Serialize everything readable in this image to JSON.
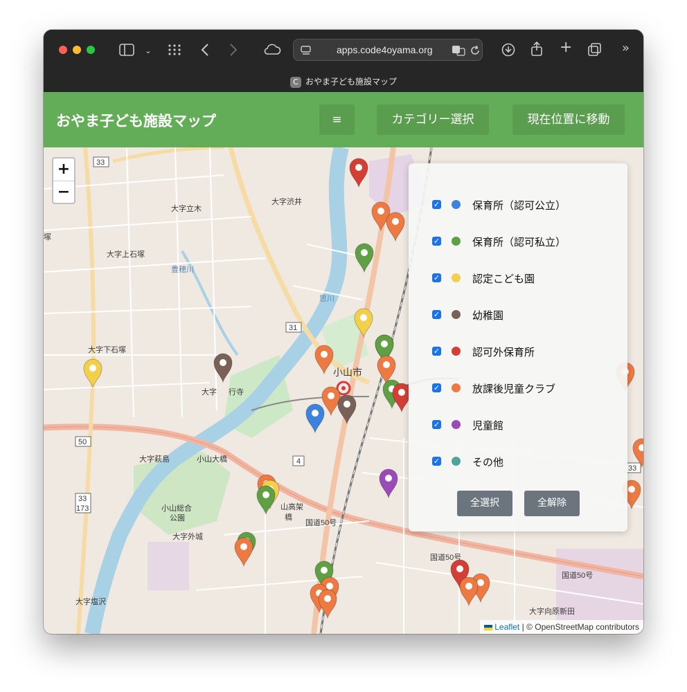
{
  "browser": {
    "url": "apps.code4oyama.org",
    "tab_title": "おやま子ども施設マップ",
    "tab_favicon": "C"
  },
  "header": {
    "title": "おやま子ども施設マップ",
    "menu_icon": "≡",
    "category_button": "カテゴリー選択",
    "location_button": "現在位置に移動"
  },
  "zoom": {
    "in": "+",
    "out": "−"
  },
  "categories": [
    {
      "label": "保育所（認可公立）",
      "color": "#3d83dd",
      "checked": true
    },
    {
      "label": "保育所（認可私立）",
      "color": "#5fa044",
      "checked": true
    },
    {
      "label": "認定こども園",
      "color": "#f2d04a",
      "checked": true
    },
    {
      "label": "幼稚園",
      "color": "#7a6158",
      "checked": true
    },
    {
      "label": "認可外保育所",
      "color": "#d33f35",
      "checked": true
    },
    {
      "label": "放課後児童クラブ",
      "color": "#ee7a43",
      "checked": true
    },
    {
      "label": "児童館",
      "color": "#9b4bb5",
      "checked": true
    },
    {
      "label": "その他",
      "color": "#4fa39a",
      "checked": true
    }
  ],
  "panel": {
    "select_all": "全選択",
    "clear_all": "全解除"
  },
  "attribution": {
    "leaflet": "Leaflet",
    "separator": "|",
    "osm": "© OpenStreetMap contributors"
  },
  "map_labels": {
    "l1": "大字渋井",
    "l2": "大字立木",
    "l3": "大字上石塚",
    "l4": "大字下石塚",
    "l5": "大字",
    "l6": "行寺",
    "l7": "大字萩島",
    "l8": "小山大橋",
    "l9": "小山市",
    "l10": "大字外城",
    "l11": "大字塩沢",
    "l12": "山高架",
    "l13": "橋",
    "l14": "大字向原新田",
    "l15": "国道50号",
    "l16": "国道50号",
    "l17": "国道50号",
    "l18": "小山総合",
    "l19": "公園",
    "l20": "思川",
    "l21": "豊穂川",
    "r1": "33",
    "r2": "31",
    "r3": "50",
    "r4": "4",
    "r5": "33",
    "r6": "173",
    "r7": "33",
    "r8": "塚"
  }
}
